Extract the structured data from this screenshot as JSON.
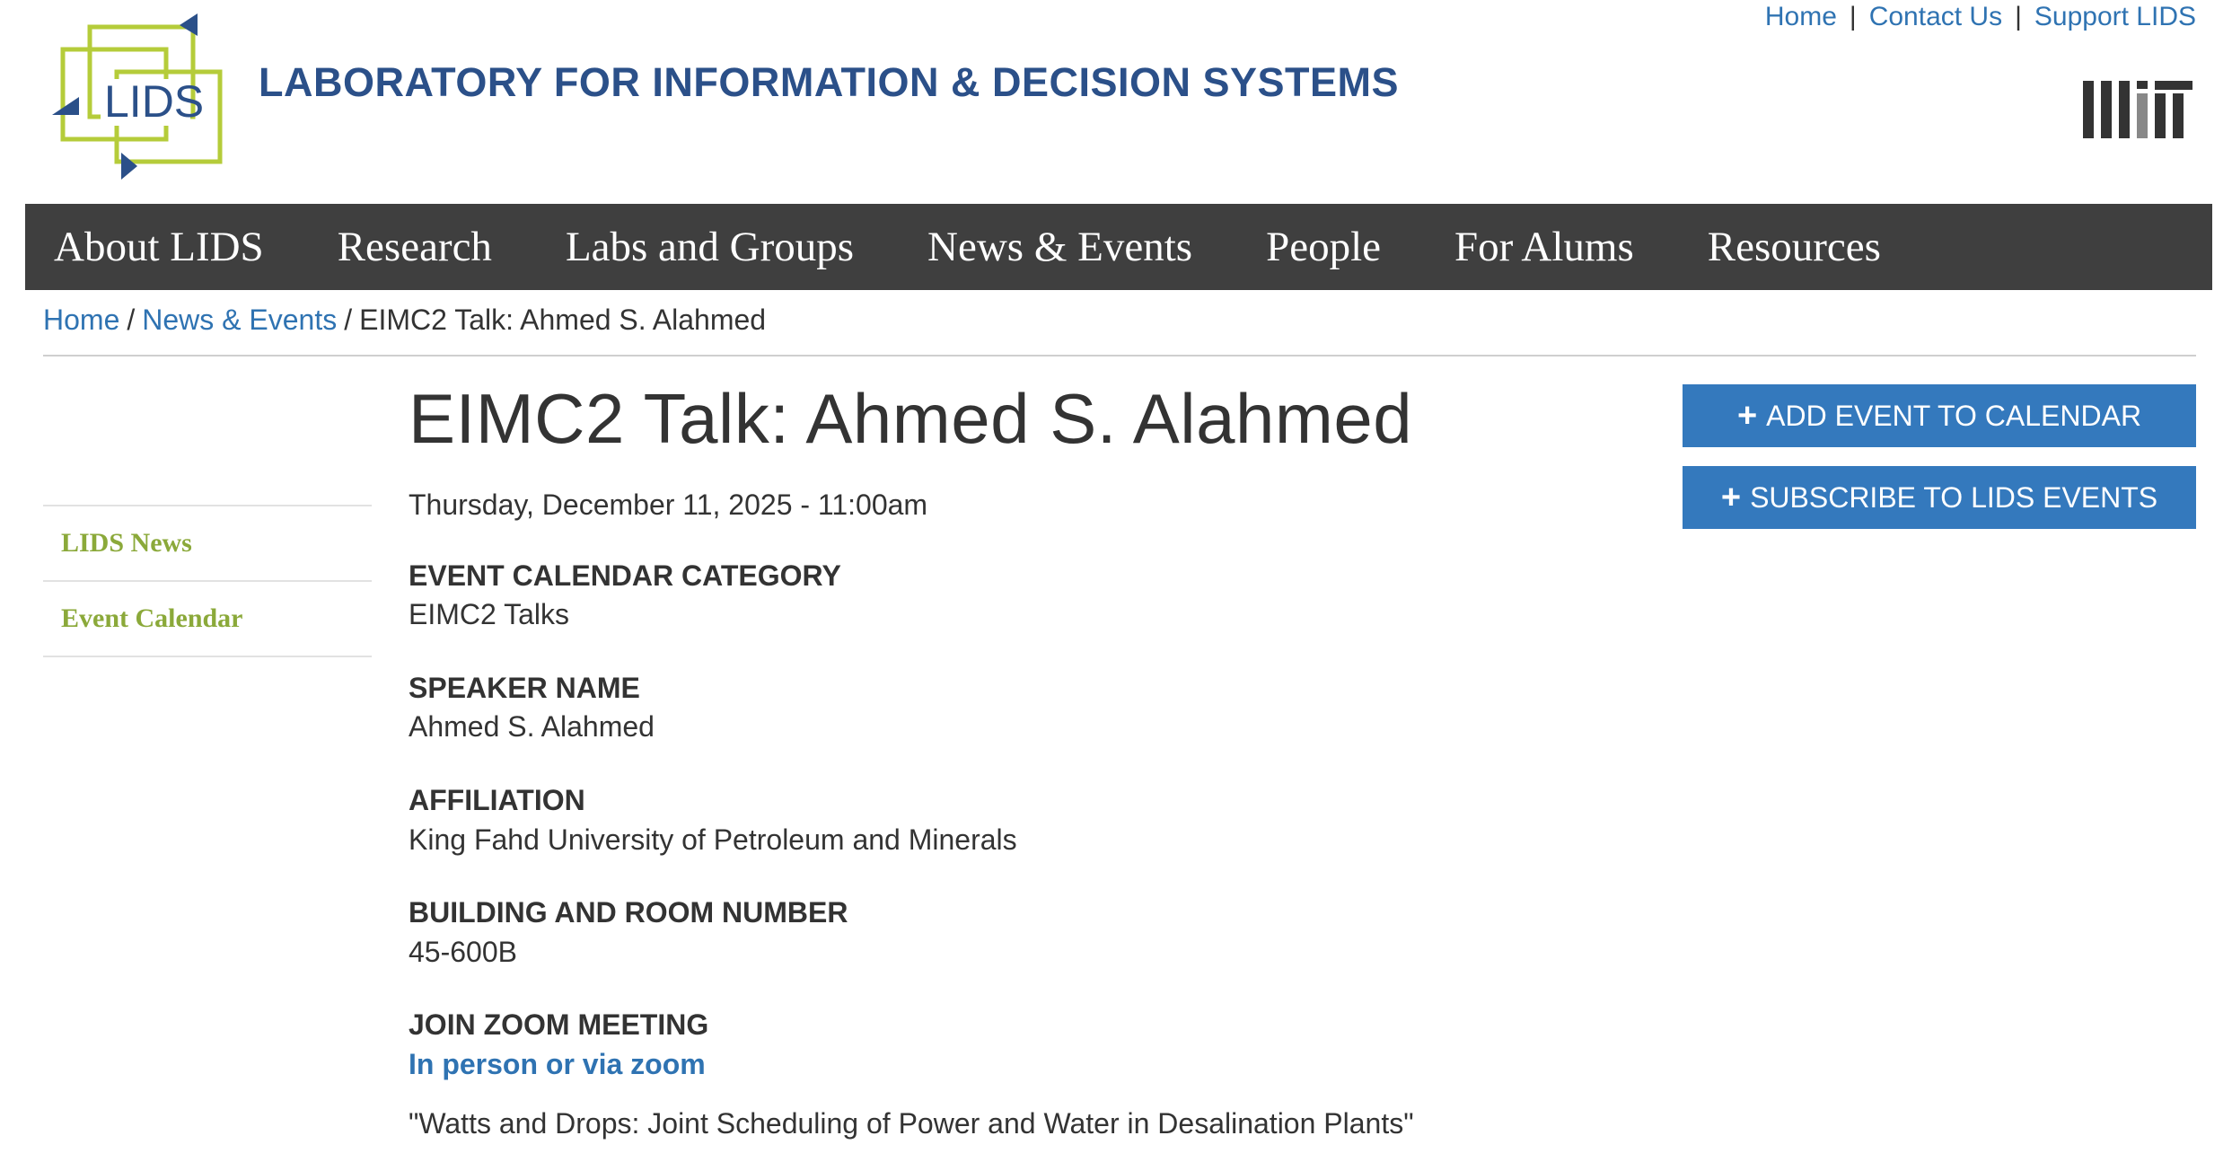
{
  "utility_links": [
    "Home",
    "Contact Us",
    "Support LIDS"
  ],
  "utility_separator": "|",
  "logo": {
    "text": "LIDS",
    "green": "#b5cc3a",
    "blue": "#2b5089"
  },
  "site_title": "LABORATORY FOR INFORMATION & DECISION SYSTEMS",
  "mit_logo_text": "MIT",
  "nav": [
    "About LIDS",
    "Research",
    "Labs and Groups",
    "News & Events",
    "People",
    "For Alums",
    "Resources"
  ],
  "breadcrumb": {
    "home": "Home",
    "section": "News & Events",
    "current": "EIMC2 Talk: Ahmed S. Alahmed",
    "separator": "/"
  },
  "sidebar": [
    "LIDS News",
    "Event Calendar"
  ],
  "event": {
    "title": "EIMC2 Talk: Ahmed S. Alahmed",
    "date": "Thursday, December 11, 2025 - 11:00am",
    "fields": [
      {
        "label": "EVENT CALENDAR CATEGORY",
        "value": "EIMC2 Talks"
      },
      {
        "label": "SPEAKER NAME",
        "value": "Ahmed S. Alahmed"
      },
      {
        "label": "AFFILIATION",
        "value": "King Fahd University of Petroleum and Minerals"
      },
      {
        "label": "BUILDING AND ROOM NUMBER",
        "value": "45-600B"
      },
      {
        "label": "JOIN ZOOM MEETING",
        "value": "In person or via zoom"
      }
    ],
    "talk_title": "\"Watts and Drops: Joint Scheduling of Power and Water in Desalination Plants\""
  },
  "buttons": {
    "add_event": "ADD EVENT TO CALENDAR",
    "subscribe": "SUBSCRIBE TO LIDS EVENTS",
    "icon": "plus-icon"
  },
  "colors": {
    "nav_bg": "#3f3f3f",
    "link": "#2f73b2",
    "button": "#3479bd",
    "sidebar_link": "#8ba93a",
    "title": "#2b5089"
  }
}
